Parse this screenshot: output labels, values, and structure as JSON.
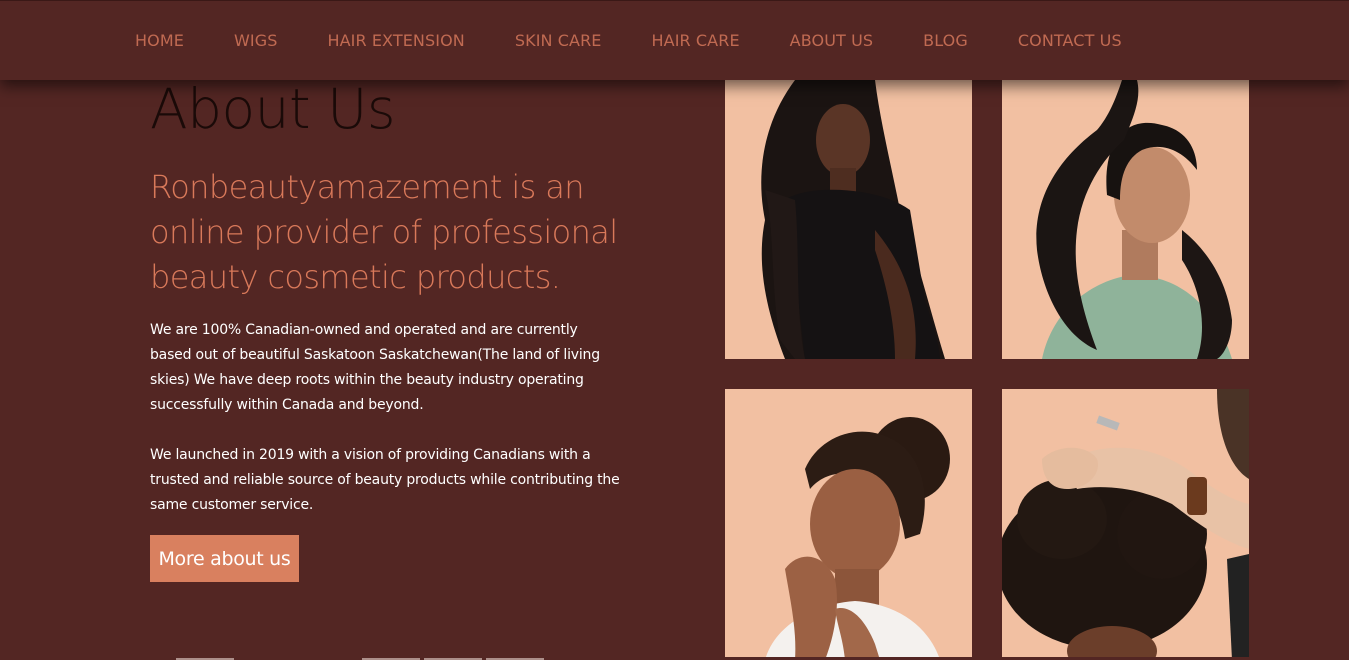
{
  "nav": {
    "items": [
      {
        "label": "HOME"
      },
      {
        "label": "WIGS"
      },
      {
        "label": "HAIR EXTENSION"
      },
      {
        "label": "SKIN CARE"
      },
      {
        "label": "HAIR CARE"
      },
      {
        "label": "ABOUT US"
      },
      {
        "label": "BLOG"
      },
      {
        "label": "CONTACT US"
      }
    ]
  },
  "about": {
    "title": "About Us",
    "tagline": "Ronbeautyamazement is an online provider of professional beauty cosmetic products.",
    "paragraph_1": "We are 100% Canadian-owned and operated and are currently based out of beautiful Saskatoon Saskatchewan(The land of living skies) We have deep roots within the beauty industry operating successfully within Canada and beyond.",
    "paragraph_2": "We launched in 2019 with a vision of providing Canadians with a trusted and reliable source of beauty products while contributing the same customer service.",
    "button_label": "More about us"
  },
  "colors": {
    "background": "#532623",
    "accent": "#d9805f",
    "tile": "#f2c0a2",
    "nav_text": "#c06a52"
  }
}
